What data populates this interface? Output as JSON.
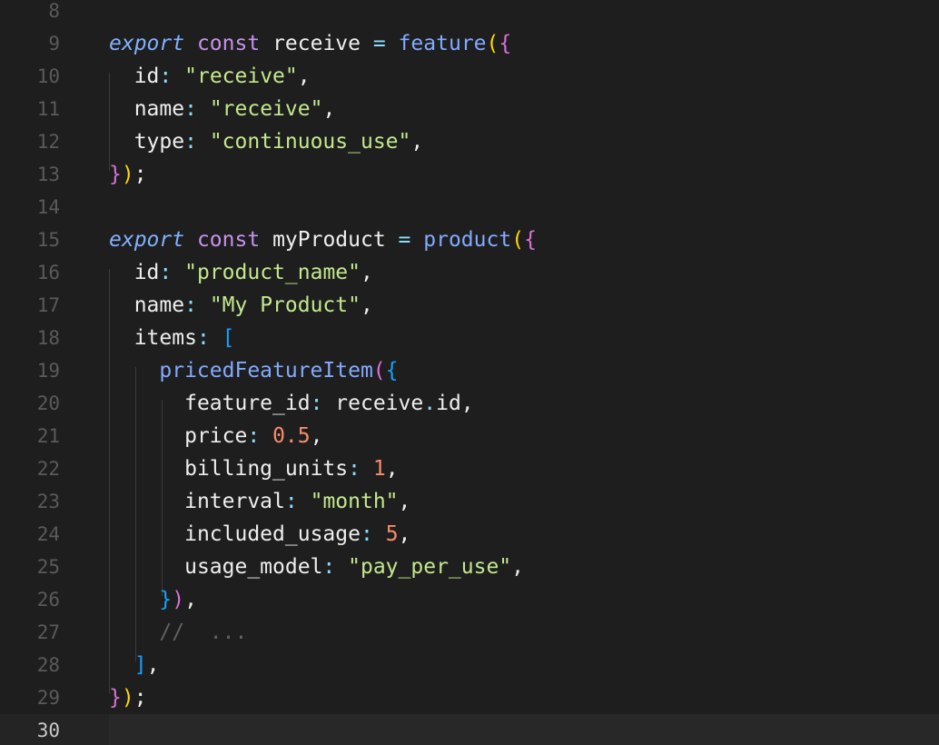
{
  "editor": {
    "colors": {
      "background": "#1e1e1e",
      "keyword_italic": "#82b1ff",
      "keyword": "#c792ea",
      "function": "#82aaff",
      "string": "#c3e88d",
      "number": "#f78c6c",
      "comment": "#616161",
      "bracket_gold": "#ffd700",
      "bracket_violet": "#da70d6",
      "bracket_blue": "#179fff"
    },
    "current_line": 30,
    "lines": [
      {
        "n": "8",
        "tokens": []
      },
      {
        "n": "9",
        "tokens": [
          {
            "t": "export",
            "c": "t-ital"
          },
          {
            "t": " ",
            "c": ""
          },
          {
            "t": "const",
            "c": "t-kw"
          },
          {
            "t": " ",
            "c": ""
          },
          {
            "t": "receive",
            "c": "t-var"
          },
          {
            "t": " ",
            "c": ""
          },
          {
            "t": "=",
            "c": "t-op"
          },
          {
            "t": " ",
            "c": ""
          },
          {
            "t": "feature",
            "c": "t-fn"
          },
          {
            "t": "(",
            "c": "t-p1"
          },
          {
            "t": "{",
            "c": "t-p2"
          }
        ]
      },
      {
        "n": "10",
        "tokens": [
          {
            "t": "  ",
            "c": ""
          },
          {
            "t": "id",
            "c": "t-key"
          },
          {
            "t": ":",
            "c": "t-punc"
          },
          {
            "t": " ",
            "c": ""
          },
          {
            "t": "\"receive\"",
            "c": "t-str"
          },
          {
            "t": ",",
            "c": "t-var"
          }
        ]
      },
      {
        "n": "11",
        "tokens": [
          {
            "t": "  ",
            "c": ""
          },
          {
            "t": "name",
            "c": "t-key"
          },
          {
            "t": ":",
            "c": "t-punc"
          },
          {
            "t": " ",
            "c": ""
          },
          {
            "t": "\"receive\"",
            "c": "t-str"
          },
          {
            "t": ",",
            "c": "t-var"
          }
        ]
      },
      {
        "n": "12",
        "tokens": [
          {
            "t": "  ",
            "c": ""
          },
          {
            "t": "type",
            "c": "t-key"
          },
          {
            "t": ":",
            "c": "t-punc"
          },
          {
            "t": " ",
            "c": ""
          },
          {
            "t": "\"continuous_use\"",
            "c": "t-str"
          },
          {
            "t": ",",
            "c": "t-var"
          }
        ]
      },
      {
        "n": "13",
        "tokens": [
          {
            "t": "}",
            "c": "t-p2"
          },
          {
            "t": ")",
            "c": "t-p1"
          },
          {
            "t": ";",
            "c": "t-var"
          }
        ]
      },
      {
        "n": "14",
        "tokens": []
      },
      {
        "n": "15",
        "tokens": [
          {
            "t": "export",
            "c": "t-ital"
          },
          {
            "t": " ",
            "c": ""
          },
          {
            "t": "const",
            "c": "t-kw"
          },
          {
            "t": " ",
            "c": ""
          },
          {
            "t": "myProduct",
            "c": "t-var"
          },
          {
            "t": " ",
            "c": ""
          },
          {
            "t": "=",
            "c": "t-op"
          },
          {
            "t": " ",
            "c": ""
          },
          {
            "t": "product",
            "c": "t-fn"
          },
          {
            "t": "(",
            "c": "t-p1"
          },
          {
            "t": "{",
            "c": "t-p2"
          }
        ]
      },
      {
        "n": "16",
        "tokens": [
          {
            "t": "  ",
            "c": ""
          },
          {
            "t": "id",
            "c": "t-key"
          },
          {
            "t": ":",
            "c": "t-punc"
          },
          {
            "t": " ",
            "c": ""
          },
          {
            "t": "\"product_name\"",
            "c": "t-str"
          },
          {
            "t": ",",
            "c": "t-var"
          }
        ]
      },
      {
        "n": "17",
        "tokens": [
          {
            "t": "  ",
            "c": ""
          },
          {
            "t": "name",
            "c": "t-key"
          },
          {
            "t": ":",
            "c": "t-punc"
          },
          {
            "t": " ",
            "c": ""
          },
          {
            "t": "\"My Product\"",
            "c": "t-str"
          },
          {
            "t": ",",
            "c": "t-var"
          }
        ]
      },
      {
        "n": "18",
        "tokens": [
          {
            "t": "  ",
            "c": ""
          },
          {
            "t": "items",
            "c": "t-key"
          },
          {
            "t": ":",
            "c": "t-punc"
          },
          {
            "t": " ",
            "c": ""
          },
          {
            "t": "[",
            "c": "t-p3"
          }
        ]
      },
      {
        "n": "19",
        "tokens": [
          {
            "t": "    ",
            "c": ""
          },
          {
            "t": "pricedFeatureItem",
            "c": "t-fn"
          },
          {
            "t": "(",
            "c": "t-p2"
          },
          {
            "t": "{",
            "c": "t-p3"
          }
        ]
      },
      {
        "n": "20",
        "tokens": [
          {
            "t": "      ",
            "c": ""
          },
          {
            "t": "feature_id",
            "c": "t-key"
          },
          {
            "t": ":",
            "c": "t-punc"
          },
          {
            "t": " ",
            "c": ""
          },
          {
            "t": "receive",
            "c": "t-var"
          },
          {
            "t": ".",
            "c": "t-punc"
          },
          {
            "t": "id",
            "c": "t-var"
          },
          {
            "t": ",",
            "c": "t-var"
          }
        ]
      },
      {
        "n": "21",
        "tokens": [
          {
            "t": "      ",
            "c": ""
          },
          {
            "t": "price",
            "c": "t-key"
          },
          {
            "t": ":",
            "c": "t-punc"
          },
          {
            "t": " ",
            "c": ""
          },
          {
            "t": "0.5",
            "c": "t-num"
          },
          {
            "t": ",",
            "c": "t-var"
          }
        ]
      },
      {
        "n": "22",
        "tokens": [
          {
            "t": "      ",
            "c": ""
          },
          {
            "t": "billing_units",
            "c": "t-key"
          },
          {
            "t": ":",
            "c": "t-punc"
          },
          {
            "t": " ",
            "c": ""
          },
          {
            "t": "1",
            "c": "t-num"
          },
          {
            "t": ",",
            "c": "t-var"
          }
        ]
      },
      {
        "n": "23",
        "tokens": [
          {
            "t": "      ",
            "c": ""
          },
          {
            "t": "interval",
            "c": "t-key"
          },
          {
            "t": ":",
            "c": "t-punc"
          },
          {
            "t": " ",
            "c": ""
          },
          {
            "t": "\"month\"",
            "c": "t-str"
          },
          {
            "t": ",",
            "c": "t-var"
          }
        ]
      },
      {
        "n": "24",
        "tokens": [
          {
            "t": "      ",
            "c": ""
          },
          {
            "t": "included_usage",
            "c": "t-key"
          },
          {
            "t": ":",
            "c": "t-punc"
          },
          {
            "t": " ",
            "c": ""
          },
          {
            "t": "5",
            "c": "t-num"
          },
          {
            "t": ",",
            "c": "t-var"
          }
        ]
      },
      {
        "n": "25",
        "tokens": [
          {
            "t": "      ",
            "c": ""
          },
          {
            "t": "usage_model",
            "c": "t-key"
          },
          {
            "t": ":",
            "c": "t-punc"
          },
          {
            "t": " ",
            "c": ""
          },
          {
            "t": "\"pay_per_use\"",
            "c": "t-str"
          },
          {
            "t": ",",
            "c": "t-var"
          }
        ]
      },
      {
        "n": "26",
        "tokens": [
          {
            "t": "    ",
            "c": ""
          },
          {
            "t": "}",
            "c": "t-p3"
          },
          {
            "t": ")",
            "c": "t-p2"
          },
          {
            "t": ",",
            "c": "t-var"
          }
        ]
      },
      {
        "n": "27",
        "tokens": [
          {
            "t": "    ",
            "c": ""
          },
          {
            "t": "//  ...",
            "c": "t-cm"
          }
        ]
      },
      {
        "n": "28",
        "tokens": [
          {
            "t": "  ",
            "c": ""
          },
          {
            "t": "]",
            "c": "t-p3"
          },
          {
            "t": ",",
            "c": "t-var"
          }
        ]
      },
      {
        "n": "29",
        "tokens": [
          {
            "t": "}",
            "c": "t-p2"
          },
          {
            "t": ")",
            "c": "t-p1"
          },
          {
            "t": ";",
            "c": "t-var"
          }
        ]
      },
      {
        "n": "30",
        "tokens": []
      }
    ]
  }
}
